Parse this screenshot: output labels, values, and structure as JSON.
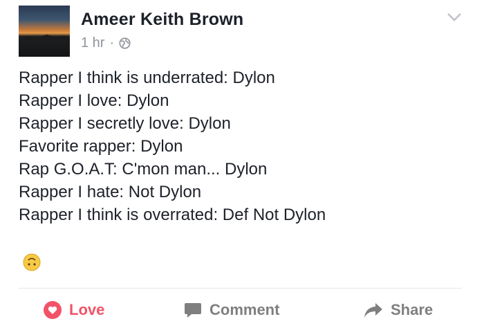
{
  "post": {
    "author": "Ameer Keith Brown",
    "time": "1 hr",
    "separator": "·",
    "privacy_icon": "globe-icon",
    "lines": [
      "Rapper I think is underrated: Dylon",
      "Rapper I love: Dylon",
      "Rapper I secretly love: Dylon",
      "Favorite rapper: Dylon",
      "Rap G.O.A.T: C'mon man... Dylon",
      "Rapper I hate: Not Dylon",
      "Rapper I think is overrated: Def Not Dylon"
    ],
    "emoji": "upside-down-face-emoji"
  },
  "actions": {
    "love_label": "Love",
    "comment_label": "Comment",
    "share_label": "Share"
  },
  "colors": {
    "love": "#f25268",
    "action_gray": "#7f7f7f",
    "meta_gray": "#90949c",
    "text": "#1d2129"
  }
}
